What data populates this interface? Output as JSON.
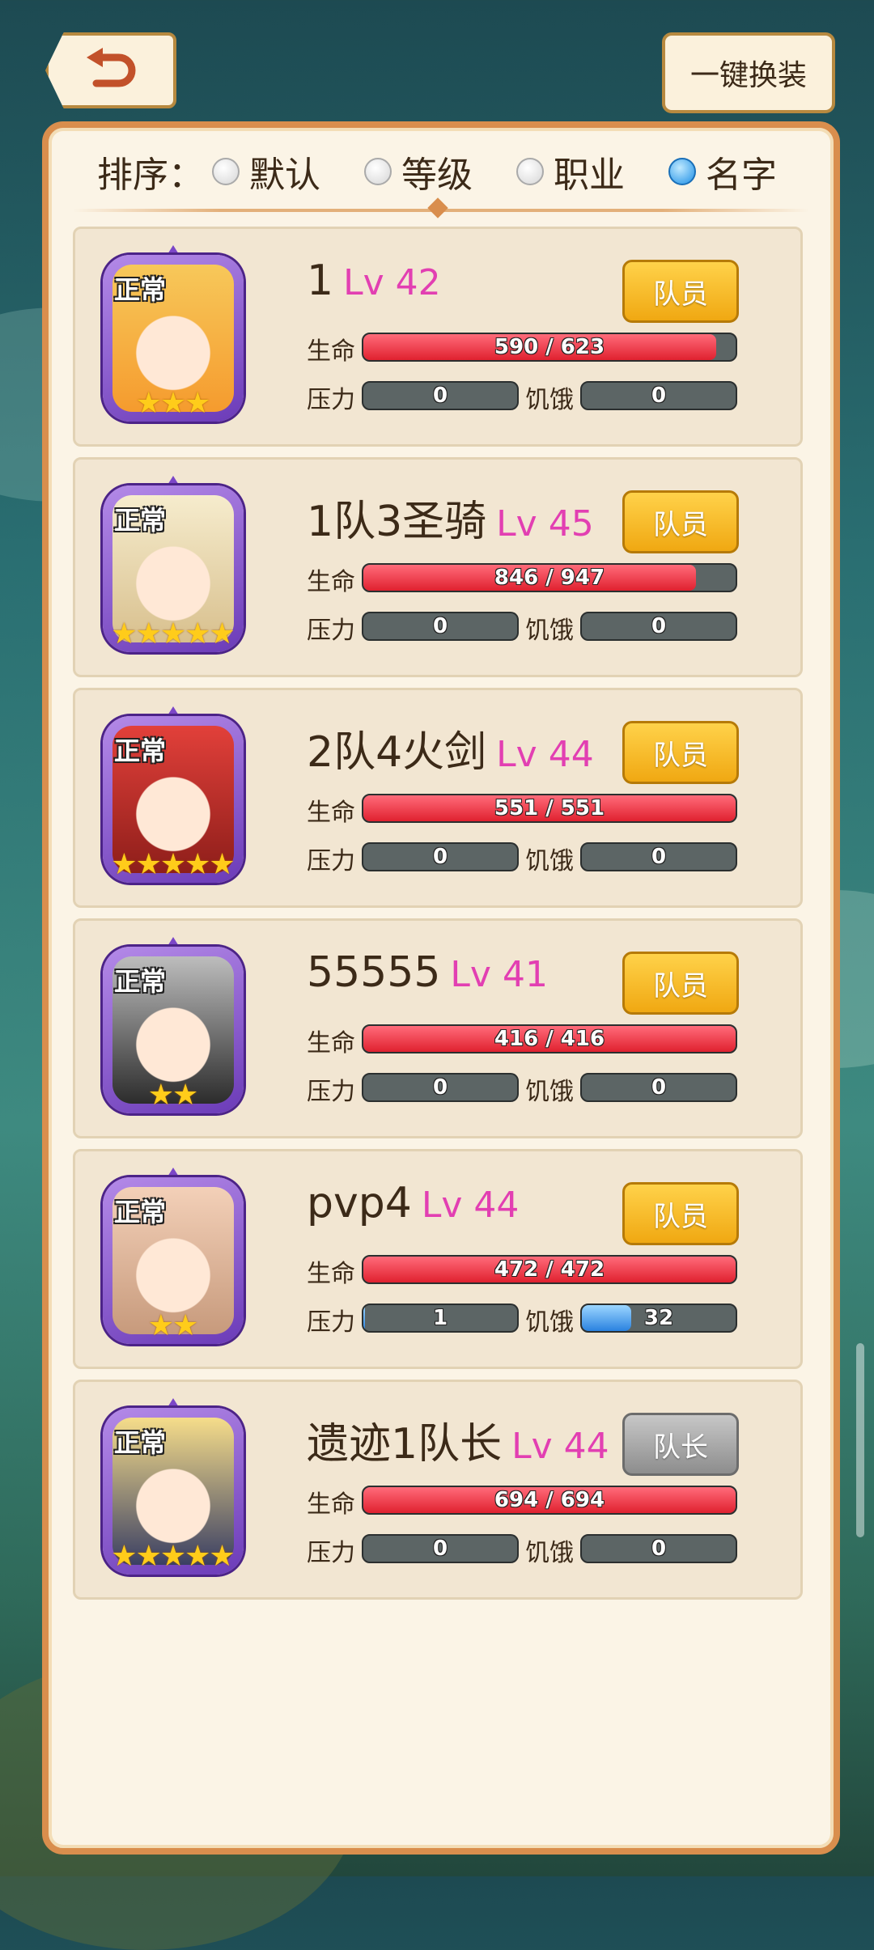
{
  "header": {
    "back_icon": "undo-arrow-icon",
    "equip_all_label": "一键换装"
  },
  "sort": {
    "label": "排序：",
    "options": [
      {
        "label": "默认",
        "selected": false
      },
      {
        "label": "等级",
        "selected": false
      },
      {
        "label": "职业",
        "selected": false
      },
      {
        "label": "名字",
        "selected": true
      }
    ]
  },
  "stat_labels": {
    "hp": "生命",
    "stress": "压力",
    "hunger": "饥饿"
  },
  "colors": {
    "hp_fill": "#e0212f",
    "hunger_fill": "#2a82e0",
    "level_text": "#e23fb2",
    "member_button": "#f0a812",
    "leader_button": "#8d8d8d"
  },
  "characters": [
    {
      "status": "正常",
      "name": "1",
      "level": "Lv 42",
      "role": "队员",
      "role_type": "member",
      "stars": 3,
      "hp": "590 / 623",
      "hp_fraction": 0.947,
      "stress": "0",
      "stress_fraction": 0,
      "hunger": "0",
      "hunger_fraction": 0,
      "portrait_colors": [
        "#f7c85a",
        "#f59b2e"
      ]
    },
    {
      "status": "正常",
      "name": "1队3圣骑",
      "level": "Lv 45",
      "role": "队员",
      "role_type": "member",
      "stars": 5,
      "hp": "846 / 947",
      "hp_fraction": 0.893,
      "stress": "0",
      "stress_fraction": 0,
      "hunger": "0",
      "hunger_fraction": 0,
      "portrait_colors": [
        "#f6eccd",
        "#d8c08e"
      ]
    },
    {
      "status": "正常",
      "name": "2队4火剑",
      "level": "Lv 44",
      "role": "队员",
      "role_type": "member",
      "stars": 5,
      "hp": "551 / 551",
      "hp_fraction": 1,
      "stress": "0",
      "stress_fraction": 0,
      "hunger": "0",
      "hunger_fraction": 0,
      "portrait_colors": [
        "#e2403a",
        "#8e1e1a"
      ]
    },
    {
      "status": "正常",
      "name": "55555",
      "level": "Lv 41",
      "role": "队员",
      "role_type": "member",
      "stars": 2,
      "hp": "416 / 416",
      "hp_fraction": 1,
      "stress": "0",
      "stress_fraction": 0,
      "hunger": "0",
      "hunger_fraction": 0,
      "portrait_colors": [
        "#bdbdbd",
        "#2c2c2c"
      ]
    },
    {
      "status": "正常",
      "name": "pvp4",
      "level": "Lv 44",
      "role": "队员",
      "role_type": "member",
      "stars": 2,
      "hp": "472 / 472",
      "hp_fraction": 1,
      "stress": "1",
      "stress_fraction": 0.01,
      "hunger": "32",
      "hunger_fraction": 0.32,
      "portrait_colors": [
        "#f3d0b8",
        "#c79a7c"
      ]
    },
    {
      "status": "正常",
      "name": "遗迹1队长",
      "level": "Lv 44",
      "role": "队长",
      "role_type": "leader",
      "stars": 5,
      "hp": "694 / 694",
      "hp_fraction": 1,
      "stress": "0",
      "stress_fraction": 0,
      "hunger": "0",
      "hunger_fraction": 0,
      "portrait_colors": [
        "#f6dd8a",
        "#3a3f63"
      ]
    }
  ]
}
